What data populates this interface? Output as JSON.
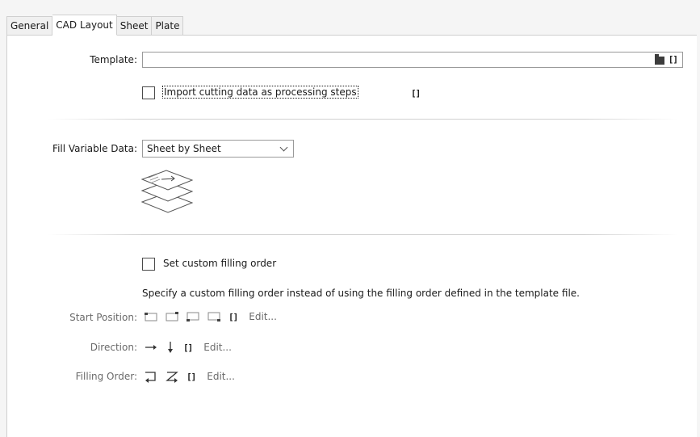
{
  "tabs": [
    {
      "label": "General",
      "active": false
    },
    {
      "label": "CAD Layout",
      "active": true
    },
    {
      "label": "Sheet",
      "active": false
    },
    {
      "label": "Plate",
      "active": false
    }
  ],
  "template": {
    "label": "Template:",
    "value": "",
    "folder_icon": "folder-icon",
    "variable_icon": "[]"
  },
  "import_cutting": {
    "label": "Import cutting data as processing steps",
    "checked": false,
    "variable_icon": "[]"
  },
  "fill_variable": {
    "label": "Fill Variable Data:",
    "selected": "Sheet by Sheet",
    "illustration": "stacked-sheets-icon"
  },
  "custom_order": {
    "checkbox_label": "Set custom filling order",
    "checked": false,
    "description": "Specify a custom filling order instead of using the filling order defined in the template file."
  },
  "start_position": {
    "label": "Start Position:",
    "icons": [
      "top-left-corner-icon",
      "top-right-corner-icon",
      "bottom-left-corner-icon",
      "bottom-right-corner-icon"
    ],
    "variable_icon": "[]",
    "edit": "Edit..."
  },
  "direction": {
    "label": "Direction:",
    "icons": [
      "arrow-right-icon",
      "arrow-down-icon"
    ],
    "variable_icon": "[]",
    "edit": "Edit..."
  },
  "filling_order": {
    "label": "Filling Order:",
    "icons": [
      "snake-order-icon",
      "z-order-icon"
    ],
    "variable_icon": "[]",
    "edit": "Edit..."
  }
}
